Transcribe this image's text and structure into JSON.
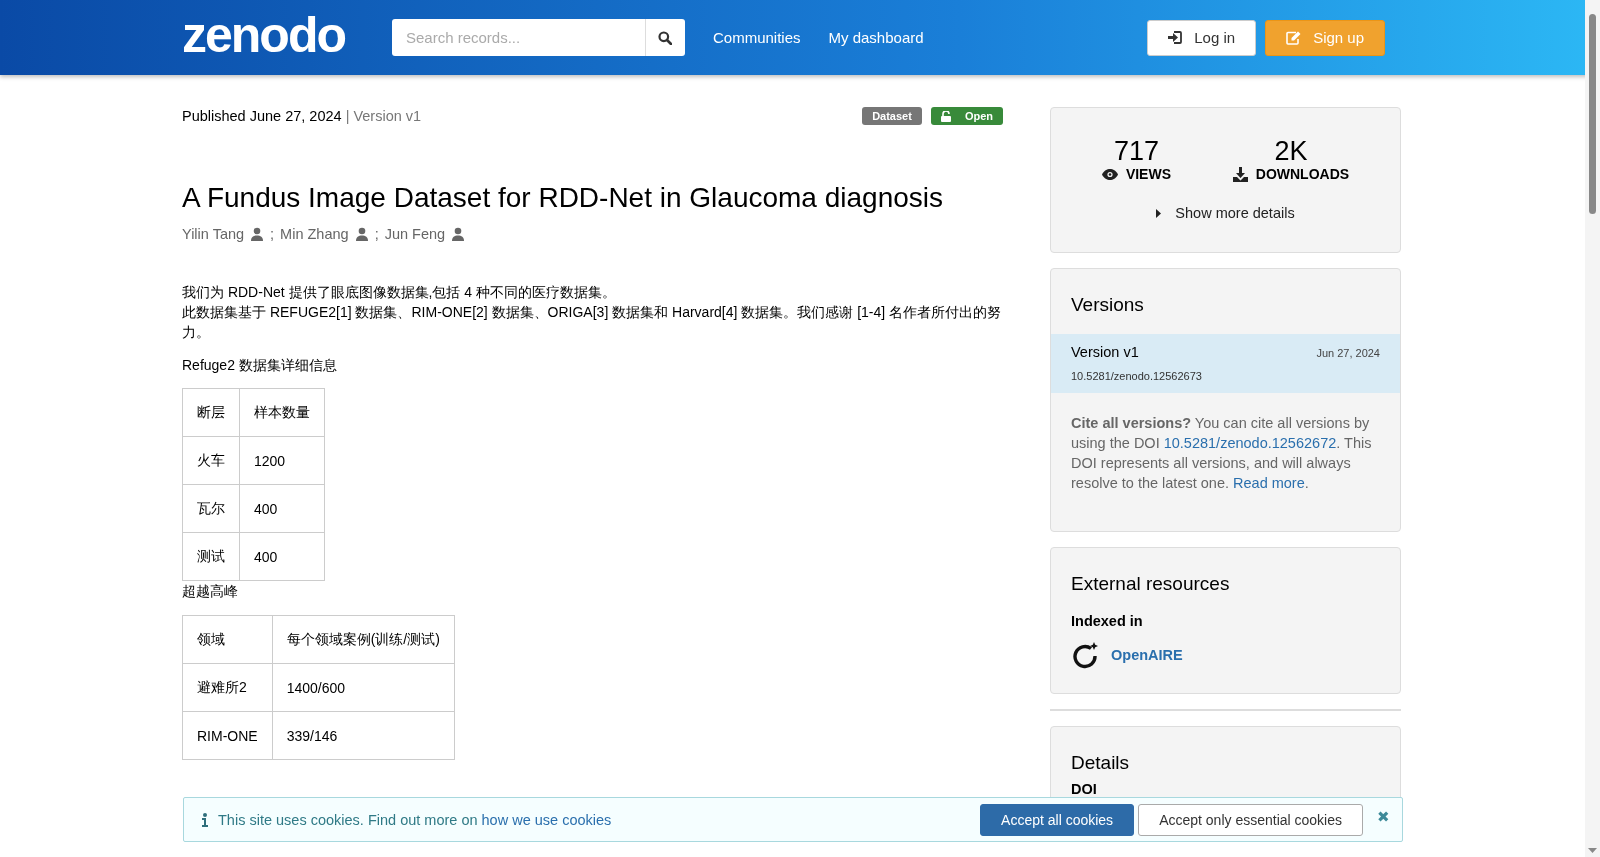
{
  "header": {
    "logo": "zenodo",
    "search": {
      "placeholder": "Search records..."
    },
    "nav": [
      "Communities",
      "My dashboard"
    ],
    "buttons": [
      {
        "label": "Log in",
        "kind": "login"
      },
      {
        "label": "Sign up",
        "kind": "signup"
      }
    ]
  },
  "record": {
    "published": "Published June 27, 2024",
    "separator": "|",
    "version": "Version v1",
    "badges": [
      {
        "label": "Dataset",
        "kind": "type"
      },
      {
        "label": "Open",
        "kind": "access"
      }
    ],
    "title": "A Fundus Image Dataset for RDD-Net in Glaucoma diagnosis",
    "creators": [
      "Yilin Tang",
      "Min Zhang",
      "Jun Feng"
    ],
    "creator_separator": ";",
    "description": [
      "我们为 RDD-Net 提供了眼底图像数据集,包括 4 种不同的医疗数据集。",
      "此数据集基于 REFUGE2[1] 数据集、RIM-ONE[2] 数据集、ORIGA[3] 数据集和 Harvard[4] 数据集。我们感谢 [1-4] 名作者所付出的努力。",
      "Refuge2 数据集详细信息"
    ],
    "tables": [
      {
        "rows": [
          [
            "断层",
            "样本数量"
          ],
          [
            "火车",
            "1200"
          ],
          [
            "瓦尔",
            "400"
          ],
          [
            "测试",
            "400"
          ]
        ]
      },
      {
        "caption": "超越高峰",
        "rows": [
          [
            "领域",
            "每个领域案例(训练/测试)"
          ],
          [
            "避难所2",
            "1400/600"
          ],
          [
            "RIM-ONE",
            "339/146"
          ]
        ]
      }
    ]
  },
  "sidebar": {
    "stats": [
      {
        "value": "717",
        "label": "VIEWS",
        "kind": "views"
      },
      {
        "value": "2K",
        "label": "DOWNLOADS",
        "kind": "downloads"
      }
    ],
    "more_details": "Show more details",
    "versions": {
      "title": "Versions",
      "items": [
        {
          "name": "Version v1",
          "date": "Jun 27, 2024",
          "doi": "10.5281/zenodo.12562673",
          "selected": true
        }
      ],
      "cite": {
        "lead": "Cite all versions?",
        "text": "You can cite all versions by using the DOI",
        "doi": "10.5281/zenodo.12562672",
        "text2": ". This DOI represents all versions, and will always resolve to the latest one.",
        "link": "Read more",
        "end": "."
      }
    },
    "external": {
      "title": "External resources",
      "subtitle": "Indexed in",
      "items": [
        "OpenAIRE"
      ]
    },
    "details": {
      "title": "Details",
      "fields": [
        "DOI"
      ]
    }
  },
  "cookie_banner": {
    "text": "This site uses cookies. Find out more on",
    "link": "how we use cookies",
    "accept_all": "Accept all cookies",
    "accept_essential": "Accept only essential cookies",
    "close": "✖"
  }
}
